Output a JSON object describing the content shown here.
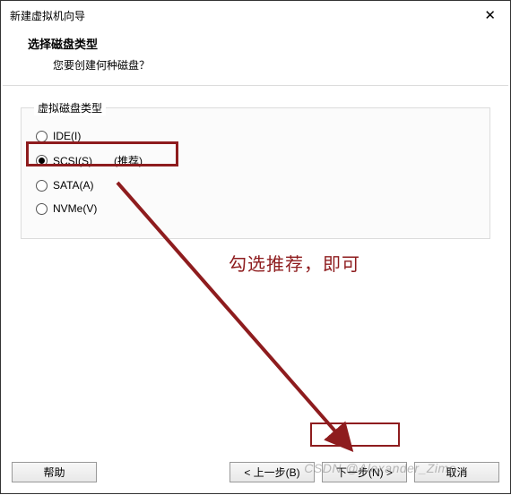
{
  "title": "新建虚拟机向导",
  "close_glyph": "✕",
  "header": {
    "title": "选择磁盘类型",
    "subtitle": "您要创建何种磁盘？"
  },
  "group": {
    "legend": "虚拟磁盘类型",
    "options": [
      {
        "label": "IDE(I)",
        "recommend": "",
        "checked": false
      },
      {
        "label": "SCSI(S)",
        "recommend": "(推荐)",
        "checked": true
      },
      {
        "label": "SATA(A)",
        "recommend": "",
        "checked": false
      },
      {
        "label": "NVMe(V)",
        "recommend": "",
        "checked": false
      }
    ]
  },
  "annotation": "勾选推荐，即可",
  "footer": {
    "help": "帮助",
    "back": "< 上一步(B)",
    "next": "下一步(N) >",
    "cancel": "取消"
  },
  "watermark": "CSDN @Alexander_Zimo",
  "colors": {
    "accent": "#8e1c1e"
  }
}
